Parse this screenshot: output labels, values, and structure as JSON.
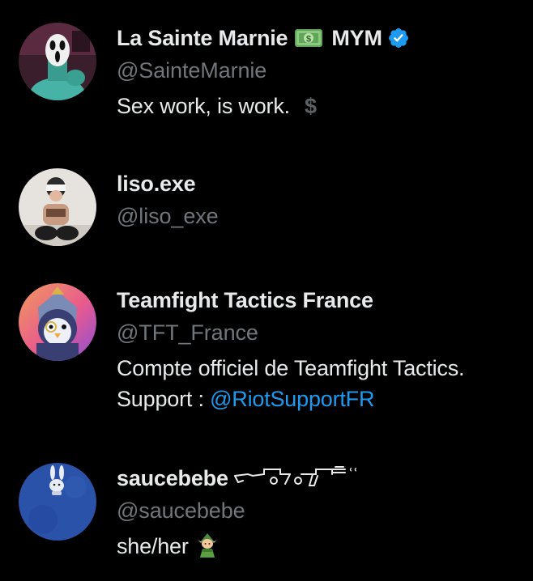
{
  "users": [
    {
      "display_name": "La Sainte Marnie",
      "name_suffix": "MYM",
      "name_emoji_icon": "banknote-icon",
      "verified": true,
      "handle": "@SainteMarnie",
      "bio": "Sex work, is work.",
      "bio_trailing_glyph": "$",
      "avatar_icon": "ghostface-mask-avatar"
    },
    {
      "display_name": "liso.exe",
      "handle": "@liso_exe",
      "avatar_icon": "person-avatar"
    },
    {
      "display_name": "Teamfight Tactics France",
      "handle": "@TFT_France",
      "bio_line1": "Compte officiel de Teamfight Tactics.",
      "bio_line2_prefix": "Support : ",
      "bio_line2_mention": "@RiotSupportFR",
      "avatar_icon": "penguin-knight-avatar"
    },
    {
      "display_name": "saucebebe",
      "name_decoration_icon": "rifle-kaomoji-icon",
      "handle": "@saucebebe",
      "bio": "she/her",
      "bio_emoji_icon": "elf-icon",
      "avatar_icon": "bunny-avatar"
    }
  ],
  "colors": {
    "background": "#000000",
    "primary_text": "#e7e9ea",
    "secondary_text": "#71767b",
    "link": "#1d9bf0",
    "verified_badge": "#1d9bf0"
  }
}
